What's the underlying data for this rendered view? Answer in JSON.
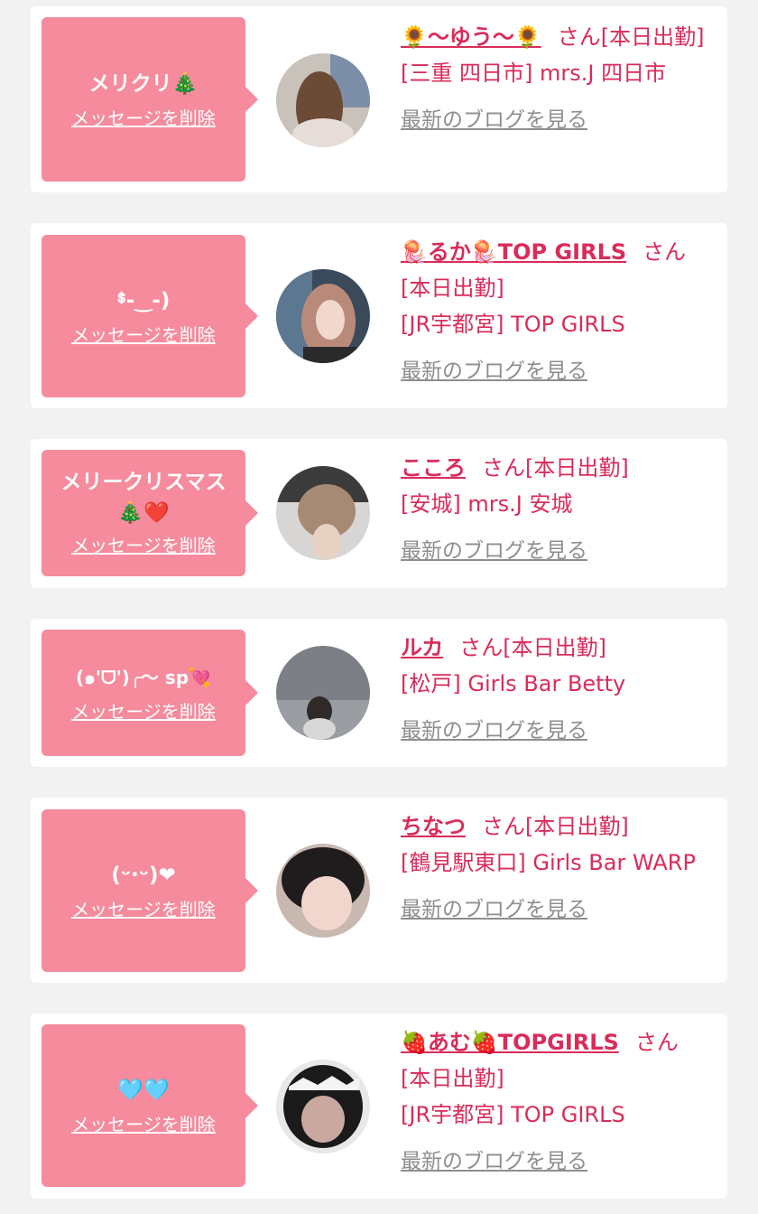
{
  "delete_label": "メッセージを削除",
  "blog_label": "最新のブログを見る",
  "honorific": "さん",
  "cards": [
    {
      "message": "メリクリ🎄",
      "name": "🌻〜ゆう〜🌻",
      "status": "[本日出勤]",
      "shop": "[三重 四日市] mrs.J 四日市"
    },
    {
      "message": "ᙚ-‿-)",
      "name": "🪼るか🪼TOP GIRLS",
      "status": "[本日出勤]",
      "shop": "[JR宇都宮] TOP GIRLS"
    },
    {
      "message": "メリークリスマス\n🎄❤️",
      "name": "こころ",
      "status": "[本日出勤]",
      "shop": "[安城] mrs.J 安城"
    },
    {
      "message": "(๑'ᗜ')╭〜 sp💘",
      "name": "ルカ",
      "status": "[本日出勤]",
      "shop": "[松戸] Girls Bar Betty"
    },
    {
      "message": "(​ᵕ·ᵕ)❤",
      "name": "ちなつ",
      "status": "[本日出勤]",
      "shop": "[鶴見駅東口] Girls Bar WARP"
    },
    {
      "message": "🩵🩵",
      "name": "🍓あむ🍓TOPGIRLS",
      "status": "[本日出勤]",
      "shop": "[JR宇都宮] TOP GIRLS"
    }
  ],
  "colors": {
    "bubble": "#f58b9c",
    "accent": "#d92c5a",
    "link_gray": "#8e8e8e",
    "background": "#f2f2f2"
  }
}
